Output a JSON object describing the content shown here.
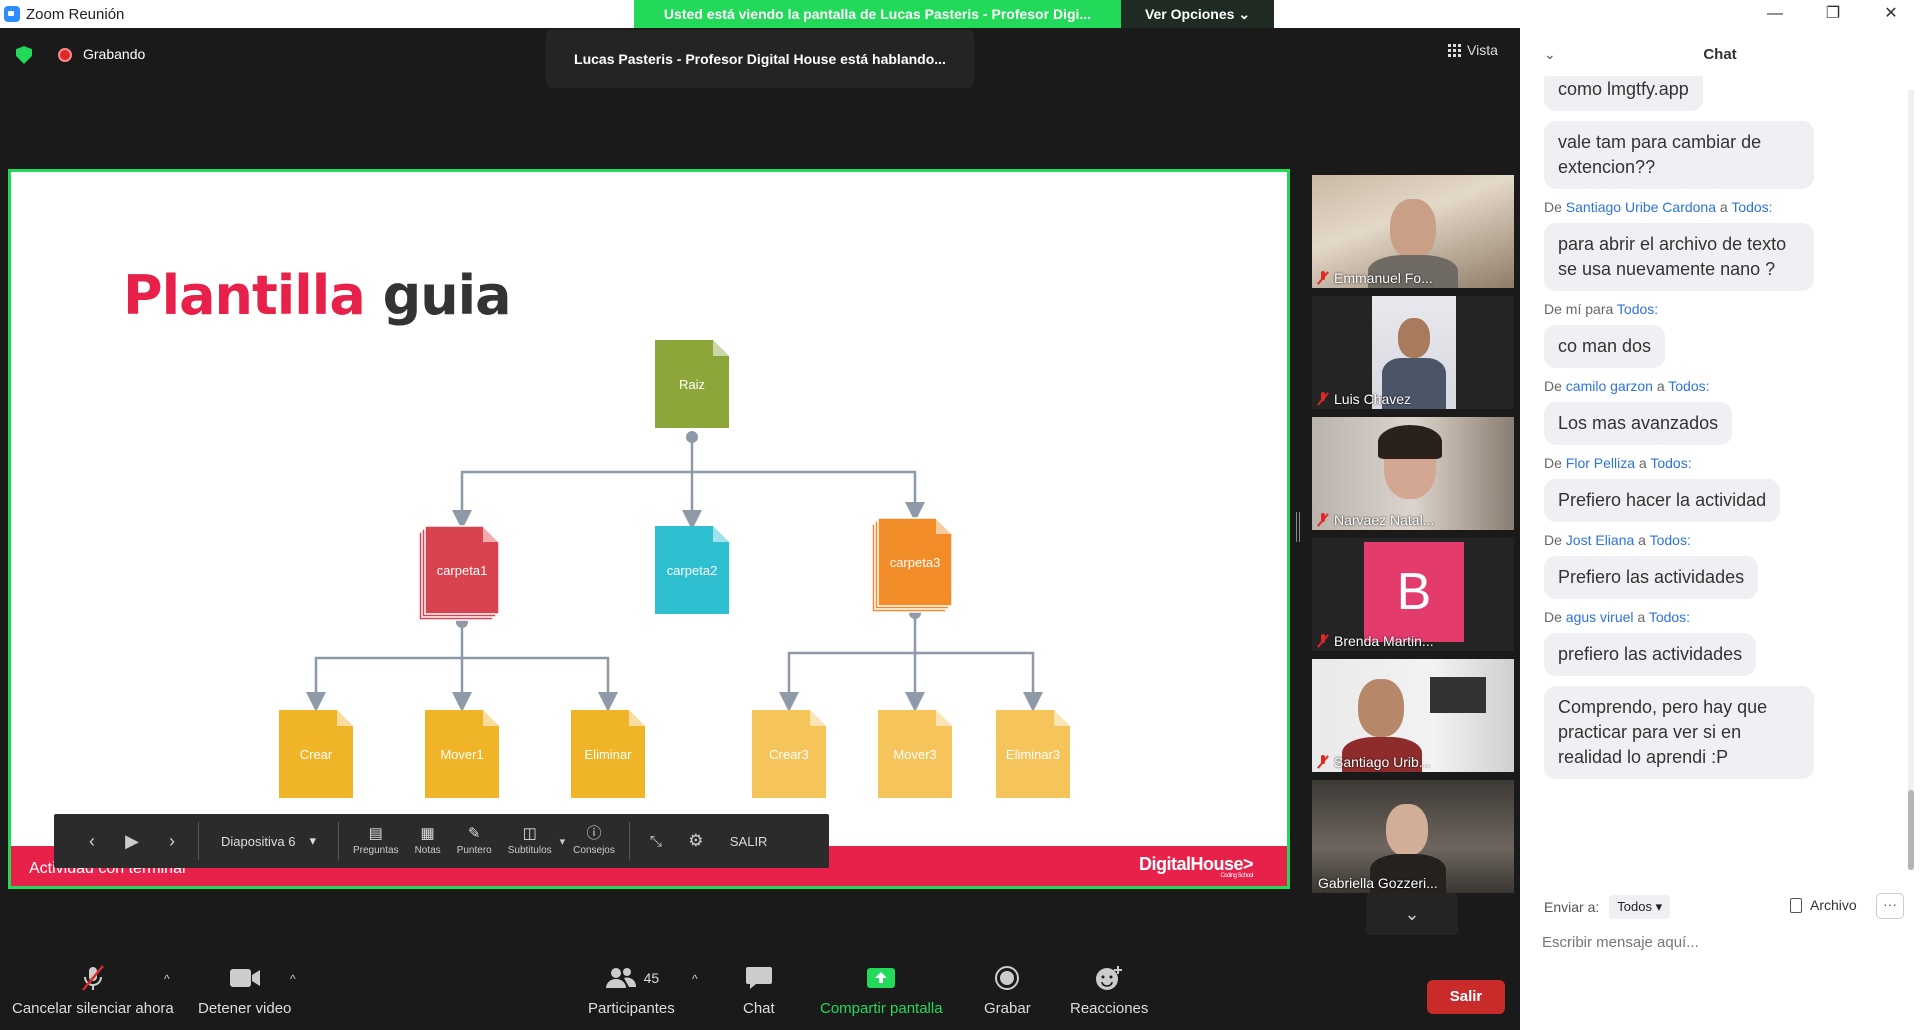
{
  "window": {
    "title": "Zoom Reunión",
    "controls": [
      "—",
      "❐",
      "✕"
    ]
  },
  "share_banner": {
    "message": "Usted está viendo la pantalla de Lucas Pasteris - Profesor Digi...",
    "options_label": "Ver Opciones"
  },
  "recording": {
    "label": "Grabando"
  },
  "speaker_banner": "Lucas Pasteris - Profesor Digital House está hablando...",
  "view_button": "Vista",
  "slide": {
    "title_part1": "Plantilla",
    "title_part2": "guia",
    "footer_text": "Actividad con terminal",
    "logo": "DigitalHouse>",
    "logo_sub": "Coding School",
    "nodes": [
      "Raiz",
      "carpeta1",
      "carpeta2",
      "carpeta3",
      "Crear",
      "Mover1",
      "Eliminar",
      "Crear3",
      "Mover3",
      "Eliminar3"
    ],
    "colors": {
      "root": "#8da63a",
      "red": "#d9434f",
      "teal": "#2ebfd0",
      "orange": "#f28c28",
      "yellow": "#f0b429",
      "light_yellow": "#f5c55b",
      "accent": "#e8214a"
    }
  },
  "presenter_bar": {
    "slide_label": "Diapositiva 6",
    "buttons": [
      {
        "label": "Preguntas",
        "icon": "questions-icon"
      },
      {
        "label": "Notas",
        "icon": "notes-icon"
      },
      {
        "label": "Puntero",
        "icon": "pointer-icon"
      },
      {
        "label": "Subtitulos",
        "icon": "subtitles-icon"
      },
      {
        "label": "Consejos",
        "icon": "info-icon"
      }
    ],
    "exit_label": "SALIR"
  },
  "gallery": [
    {
      "name": "Emmanuel Fo..."
    },
    {
      "name": "Luis Chavez"
    },
    {
      "name": "Narvaez Natal..."
    },
    {
      "name": "Brenda Martin...",
      "initial": "B"
    },
    {
      "name": "Santiago Urib..."
    },
    {
      "name": "Gabriella Gozzeri..."
    }
  ],
  "toolbar": {
    "mute_label": "Cancelar silenciar ahora",
    "video_label": "Detener video",
    "participants_label": "Participantes",
    "participants_count": "45",
    "chat_label": "Chat",
    "share_label": "Compartir pantalla",
    "record_label": "Grabar",
    "reactions_label": "Reacciones",
    "leave_label": "Salir"
  },
  "chat": {
    "header": "Chat",
    "messages": [
      {
        "from": "",
        "to": "",
        "text": "como lmgtfy.app"
      },
      {
        "from": "",
        "to": "",
        "text": "vale tam para cambiar de extencion??"
      },
      {
        "from": "Santiago Uribe Cardona",
        "to": "Todos:",
        "text": "para abrir el archivo de texto se usa nuevamente nano ?"
      },
      {
        "from": "mí",
        "to": "Todos:",
        "text": "co man dos"
      },
      {
        "from": "camilo garzon",
        "to": "Todos:",
        "text": "Los mas avanzados"
      },
      {
        "from": "Flor Pelliza",
        "to": "Todos:",
        "text": "Prefiero hacer la actividad"
      },
      {
        "from": "Jost Eliana",
        "to": "Todos:",
        "text": "Prefiero las actividades"
      },
      {
        "from": "agus viruel",
        "to": "Todos:",
        "text": "prefiero las actividades"
      },
      {
        "from": "",
        "to": "",
        "text": "Comprendo, pero hay que practicar para ver si en realidad lo aprendi :P"
      }
    ],
    "send_to_label": "Enviar a:",
    "send_to_value": "Todos",
    "file_label": "Archivo",
    "input_placeholder": "Escribir mensaje aquí..."
  }
}
